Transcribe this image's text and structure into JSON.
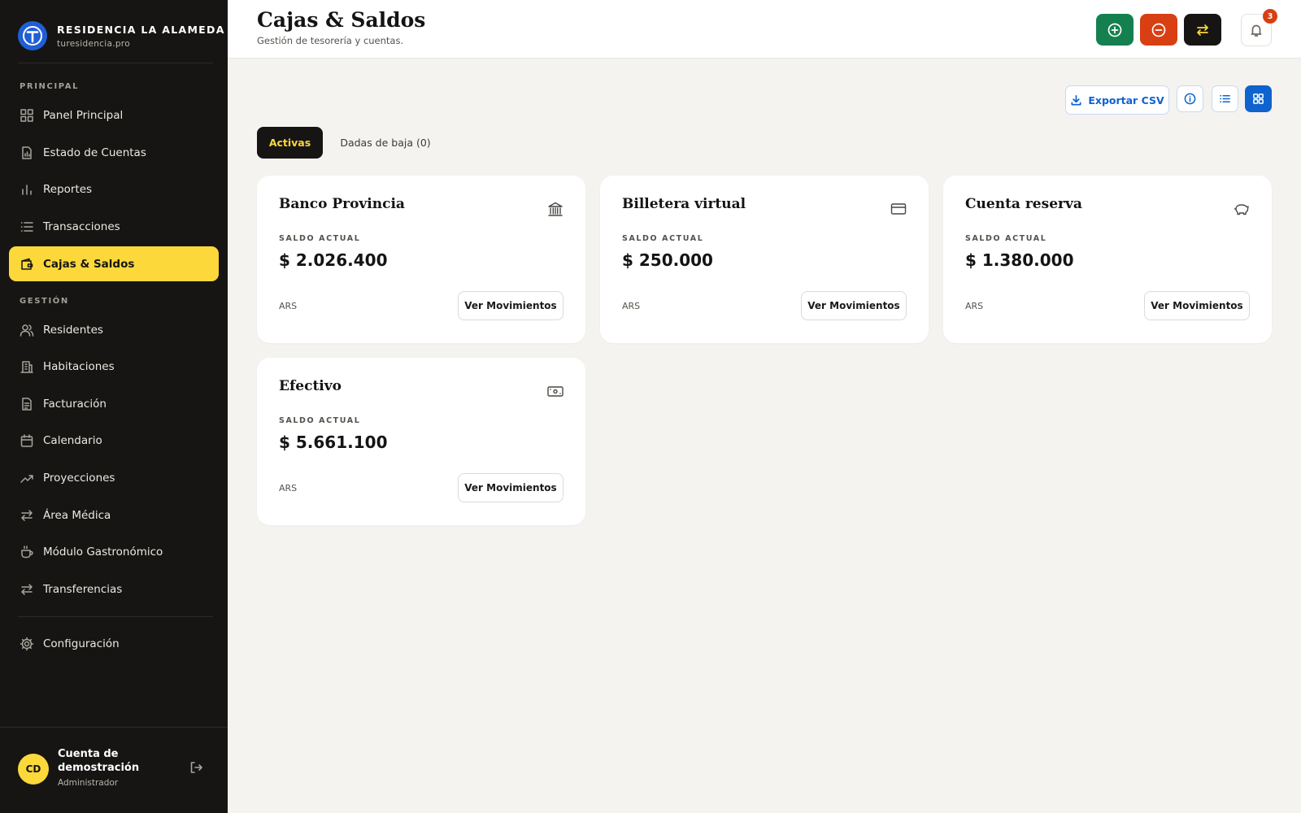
{
  "brand": {
    "name": "RESIDENCIA LA ALAMEDA",
    "url": "turesidencia.pro"
  },
  "sidebar": {
    "section_principal": "PRINCIPAL",
    "section_gestion": "GESTIÓN",
    "items": [
      {
        "label": "Panel Principal",
        "icon": "dashboard-icon"
      },
      {
        "label": "Estado de Cuentas",
        "icon": "report-file-icon"
      },
      {
        "label": "Reportes",
        "icon": "bar-chart-icon"
      },
      {
        "label": "Transacciones",
        "icon": "list-icon"
      },
      {
        "label": "Cajas & Saldos",
        "icon": "wallet-icon",
        "active": true
      },
      {
        "label": "Residentes",
        "icon": "users-icon"
      },
      {
        "label": "Habitaciones",
        "icon": "building-icon"
      },
      {
        "label": "Facturación",
        "icon": "invoice-icon"
      },
      {
        "label": "Calendario",
        "icon": "calendar-icon"
      },
      {
        "label": "Proyecciones",
        "icon": "trend-icon"
      },
      {
        "label": "Área Médica",
        "icon": "arrows-icon"
      },
      {
        "label": "Módulo Gastronómico",
        "icon": "coffee-icon"
      },
      {
        "label": "Transferencias",
        "icon": "arrows-icon"
      },
      {
        "label": "Configuración",
        "icon": "gear-icon"
      }
    ]
  },
  "user": {
    "initials": "CD",
    "name": "Cuenta de demostración",
    "role": "Administrador"
  },
  "header": {
    "title": "Cajas & Saldos",
    "subtitle": "Gestión de tesorería y cuentas.",
    "notifications_count": "3"
  },
  "toolbar": {
    "export_label": "Exportar CSV"
  },
  "tabs": {
    "active": "Activas",
    "inactive": "Dadas de baja (0)"
  },
  "accounts": [
    {
      "name": "Banco Provincia",
      "label": "SALDO ACTUAL",
      "balance": "$ 2.026.400",
      "currency": "ARS",
      "button": "Ver Movimientos",
      "icon": "bank-icon"
    },
    {
      "name": "Billetera virtual",
      "label": "SALDO ACTUAL",
      "balance": "$ 250.000",
      "currency": "ARS",
      "button": "Ver Movimientos",
      "icon": "credit-card-icon"
    },
    {
      "name": "Cuenta reserva",
      "label": "SALDO ACTUAL",
      "balance": "$ 1.380.000",
      "currency": "ARS",
      "button": "Ver Movimientos",
      "icon": "piggy-bank-icon"
    },
    {
      "name": "Efectivo",
      "label": "SALDO ACTUAL",
      "balance": "$ 5.661.100",
      "currency": "ARS",
      "button": "Ver Movimientos",
      "icon": "cash-icon"
    }
  ],
  "colors": {
    "sidebar_bg": "#161513",
    "accent_yellow": "#fdd83a",
    "income_green": "#15804f",
    "expense_red": "#d83f13",
    "primary_blue": "#0e63cf"
  }
}
